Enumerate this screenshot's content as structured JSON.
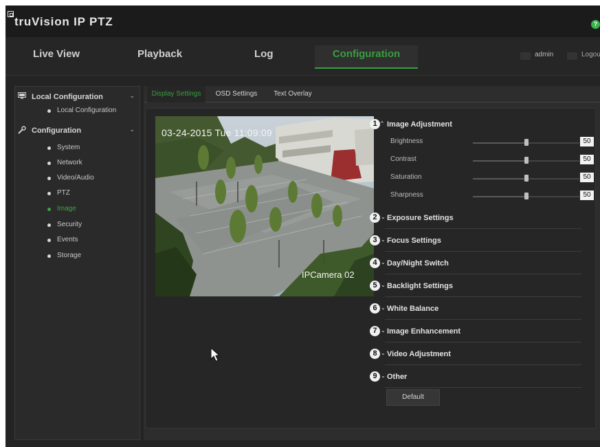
{
  "app": {
    "logo_text": "truVision IP PTZ"
  },
  "nav": {
    "tabs": [
      "Live View",
      "Playback",
      "Log",
      "Configuration"
    ],
    "active_tab": "Configuration",
    "user": "admin",
    "logout": "Logou"
  },
  "sidebar": {
    "local_group": "Local Configuration",
    "local_items": [
      "Local Configuration"
    ],
    "config_group": "Configuration",
    "config_items": [
      "System",
      "Network",
      "Video/Audio",
      "PTZ",
      "Image",
      "Security",
      "Events",
      "Storage"
    ],
    "active_item": "Image"
  },
  "subtabs": [
    "Display Settings",
    "OSD Settings",
    "Text Overlay"
  ],
  "preview": {
    "osd_datetime": "03-24-2015 Tue 11:09:09",
    "osd_camera_name": "IPCamera 02"
  },
  "image_adjustment": {
    "number": "1",
    "title": "Image Adjustment",
    "sliders": [
      {
        "label": "Brightness",
        "value": 50
      },
      {
        "label": "Contrast",
        "value": 50
      },
      {
        "label": "Saturation",
        "value": 50
      },
      {
        "label": "Sharpness",
        "value": 50
      }
    ]
  },
  "collapsed_sections": [
    {
      "number": "2",
      "title": "Exposure Settings"
    },
    {
      "number": "3",
      "title": "Focus Settings"
    },
    {
      "number": "4",
      "title": "Day/Night Switch"
    },
    {
      "number": "5",
      "title": "Backlight Settings"
    },
    {
      "number": "6",
      "title": "White Balance"
    },
    {
      "number": "7",
      "title": "Image Enhancement"
    },
    {
      "number": "8",
      "title": "Video Adjustment"
    },
    {
      "number": "9",
      "title": "Other"
    }
  ],
  "default_button": "Default",
  "colors": {
    "accent_green": "#3a9d3f",
    "help_icon": "#3ab14a",
    "background": "#242424"
  },
  "icons": [
    "logo-mark-icon",
    "help-icon",
    "monitor-icon",
    "wrench-icon",
    "chevron-down-icon",
    "chevron-up-icon",
    "mouse-pointer-icon"
  ]
}
